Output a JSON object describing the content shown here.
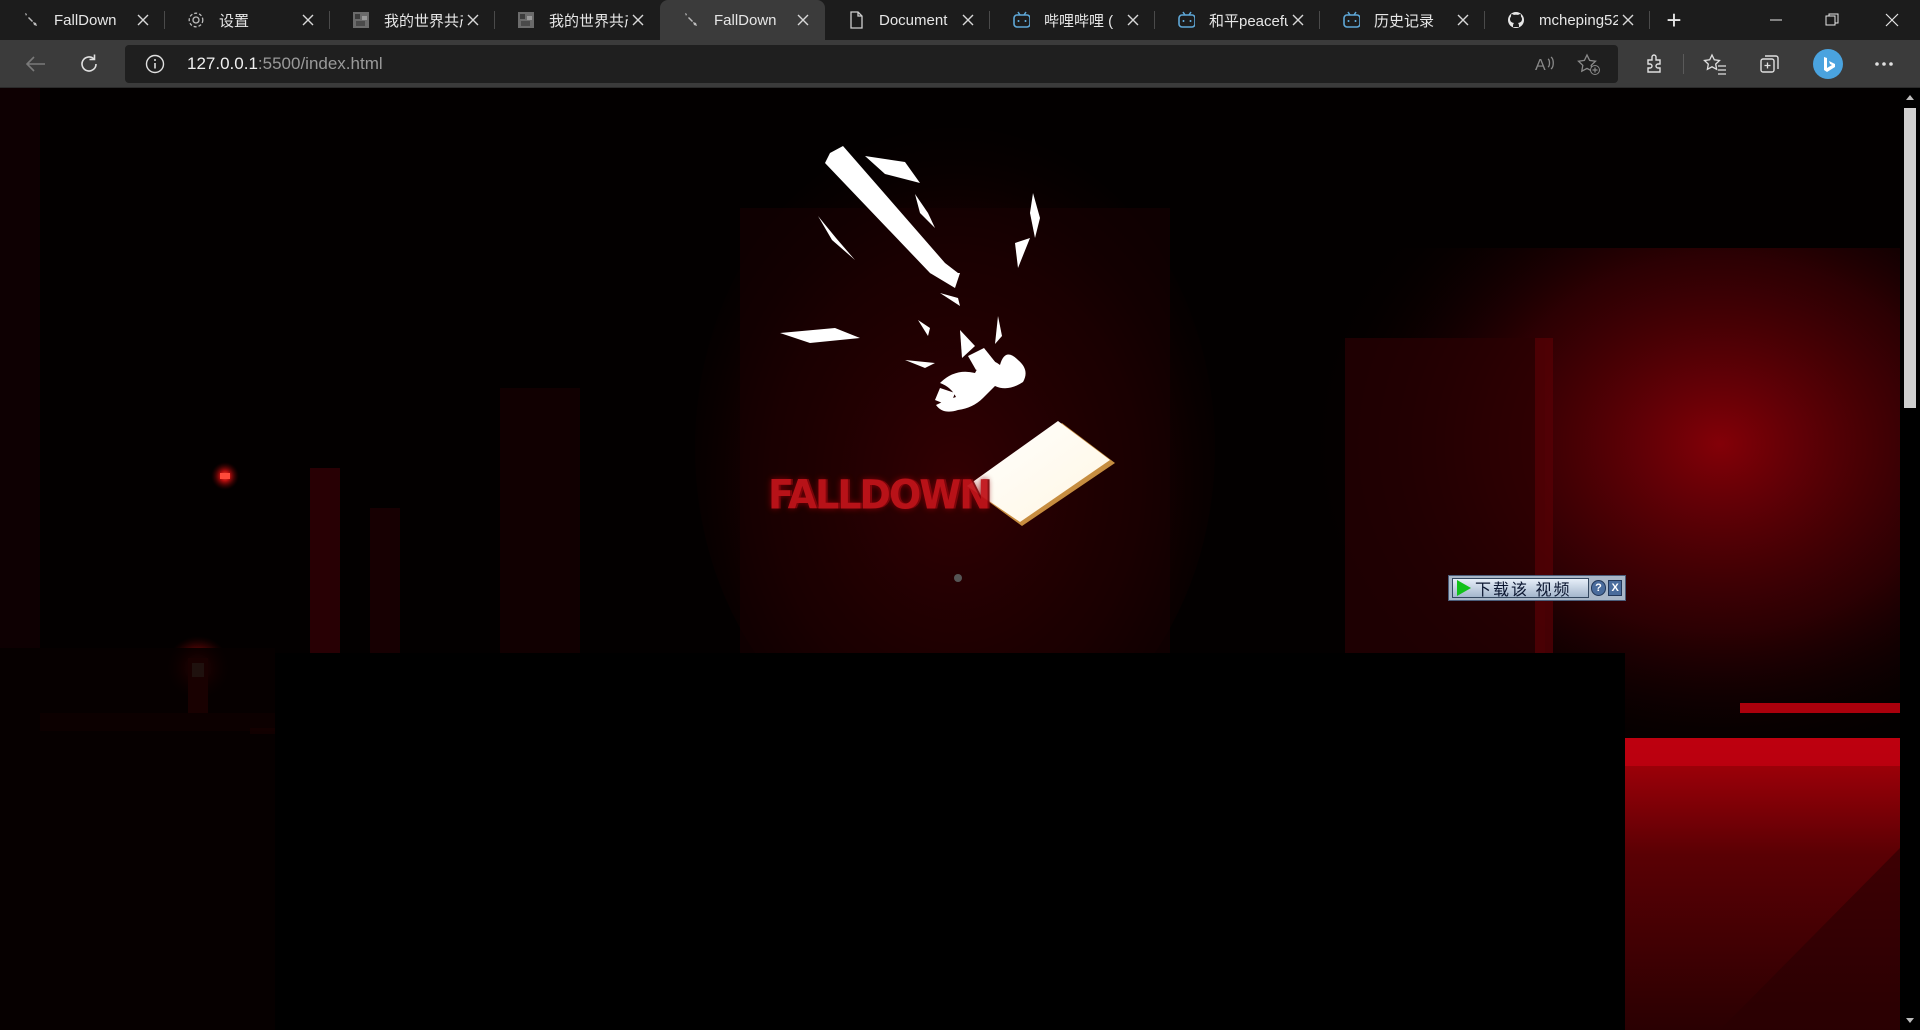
{
  "tabs": [
    {
      "title": "FallDown",
      "icon": "falldown-favicon-icon",
      "active": false
    },
    {
      "title": "设置",
      "icon": "gear-icon",
      "active": false
    },
    {
      "title": "我的世界共产",
      "icon": "minecraft-favicon-icon",
      "active": false
    },
    {
      "title": "我的世界共产",
      "icon": "minecraft-favicon-icon",
      "active": false
    },
    {
      "title": "FallDown",
      "icon": "falldown-favicon-icon",
      "active": true
    },
    {
      "title": "Document",
      "icon": "document-icon",
      "active": false
    },
    {
      "title": "哔哩哔哩 (",
      "icon": "bilibili-icon",
      "active": false
    },
    {
      "title": "和平peacefu",
      "icon": "bilibili-icon",
      "active": false
    },
    {
      "title": "历史记录",
      "icon": "bilibili-icon",
      "active": false
    },
    {
      "title": "mcheping52",
      "icon": "github-icon",
      "active": false
    }
  ],
  "address": {
    "host": "127.0.0.1",
    "path": ":5500/index.html"
  },
  "page": {
    "logo_text": "FALLDOWN"
  },
  "download_bar": {
    "label": "下载该 视频",
    "help": "?",
    "close": "X"
  },
  "colors": {
    "tabstrip": "#1c1c1c",
    "toolbar": "#3b3b3b",
    "accent_red": "#c0141a",
    "profile": "#4aa3df"
  }
}
